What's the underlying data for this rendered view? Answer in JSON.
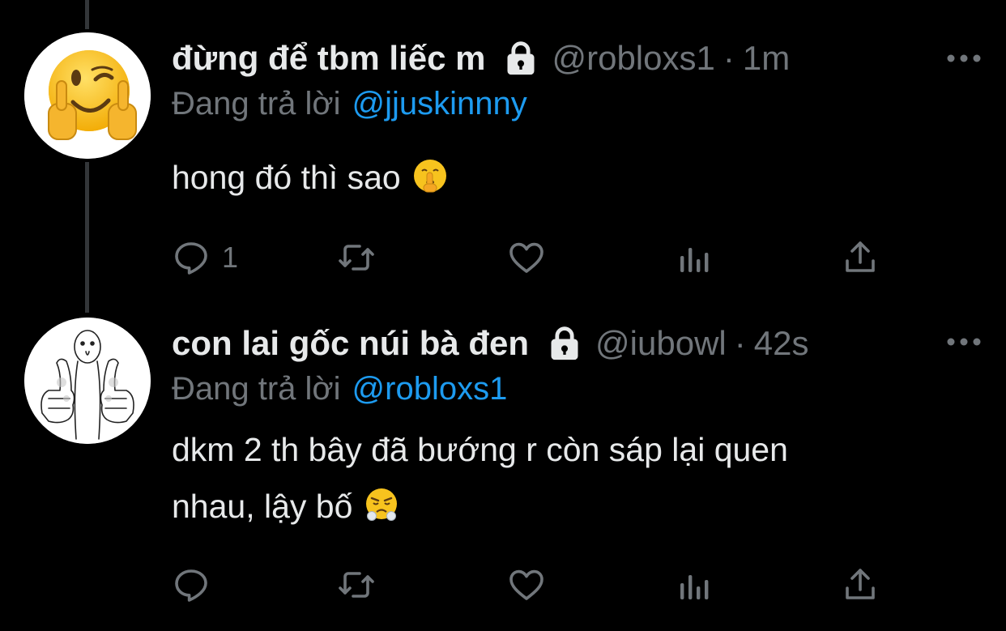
{
  "tweets": [
    {
      "display_name": "đừng để tbm liếc m",
      "handle": "@robloxs1",
      "separator": "·",
      "time": "1m",
      "reply_prefix": "Đang trả lời",
      "reply_to": "@jjuskinnny",
      "text": "hong đó thì sao",
      "emoji": "shushing-face-emoji",
      "reply_count": "1",
      "avatar": "winking-face-with-middle-fingers-avatar"
    },
    {
      "display_name": "con lai gốc núi bà đen",
      "handle": "@iubowl",
      "separator": "·",
      "time": "42s",
      "reply_prefix": "Đang trả lời",
      "reply_to": "@robloxs1",
      "text_line1": "dkm 2 th bây đã bướng r còn sáp lại quen",
      "text_line2": "nhau, lậy bố",
      "emoji": "face-with-steam-from-nose-emoji",
      "reply_count": "",
      "avatar": "thumbs-up-sketch-avatar"
    }
  ],
  "icons": {
    "lock": "lock-icon",
    "more": "more-options-icon",
    "reply": "reply-icon",
    "retweet": "retweet-icon",
    "like": "like-icon",
    "analytics": "analytics-icon",
    "share": "share-icon"
  },
  "colors": {
    "background": "#000000",
    "primary_text": "#e7e9ea",
    "secondary_text": "#71767b",
    "link": "#1d9bf0",
    "thread_line": "#333639"
  }
}
